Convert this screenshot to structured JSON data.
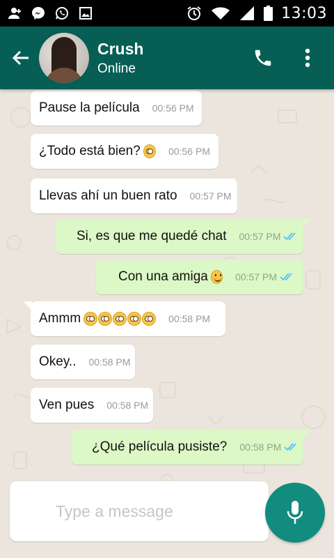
{
  "status_bar": {
    "time": "13:03",
    "left_icons": [
      "add-user-icon",
      "messenger-icon",
      "whatsapp-icon",
      "image-icon"
    ],
    "right_icons": [
      "alarm-icon",
      "wifi-icon",
      "signal-icon",
      "battery-icon"
    ]
  },
  "header": {
    "contact_name": "Crush",
    "contact_status": "Online",
    "icons": [
      "back-arrow-icon",
      "phone-icon",
      "more-vert-icon"
    ]
  },
  "messages": [
    {
      "direction": "in",
      "text": "Pause la película",
      "time": "00:56 PM"
    },
    {
      "direction": "in",
      "text": "¿Todo está bien?",
      "emoji": [
        "flushed"
      ],
      "time": "00:56 PM"
    },
    {
      "direction": "in",
      "text": "Llevas ahí un buen rato",
      "time": "00:57 PM"
    },
    {
      "direction": "out",
      "text": "Si, es que me quedé chat",
      "time": "00:57 PM",
      "status": "read"
    },
    {
      "direction": "out",
      "text": "Con una amiga",
      "emoji": [
        "smile"
      ],
      "time": "00:57 PM",
      "status": "read"
    },
    {
      "direction": "in",
      "text": "Ammm",
      "emoji": [
        "flushed",
        "flushed",
        "flushed",
        "flushed",
        "flushed"
      ],
      "time": "00:58 PM"
    },
    {
      "direction": "in",
      "text": "Okey..",
      "time": "00:58 PM"
    },
    {
      "direction": "in",
      "text": "Ven pues",
      "time": "00:58 PM"
    },
    {
      "direction": "out",
      "text": "¿Qué película pusiste?",
      "time": "00:58 PM",
      "status": "read"
    }
  ],
  "composer": {
    "placeholder": "Type a message",
    "mic_icon": "mic-icon"
  },
  "colors": {
    "header": "#075e54",
    "outgoing_bubble": "#dcf8c6",
    "incoming_bubble": "#ffffff",
    "read_ticks": "#4fc3f7",
    "mic_button": "#128c7e"
  }
}
